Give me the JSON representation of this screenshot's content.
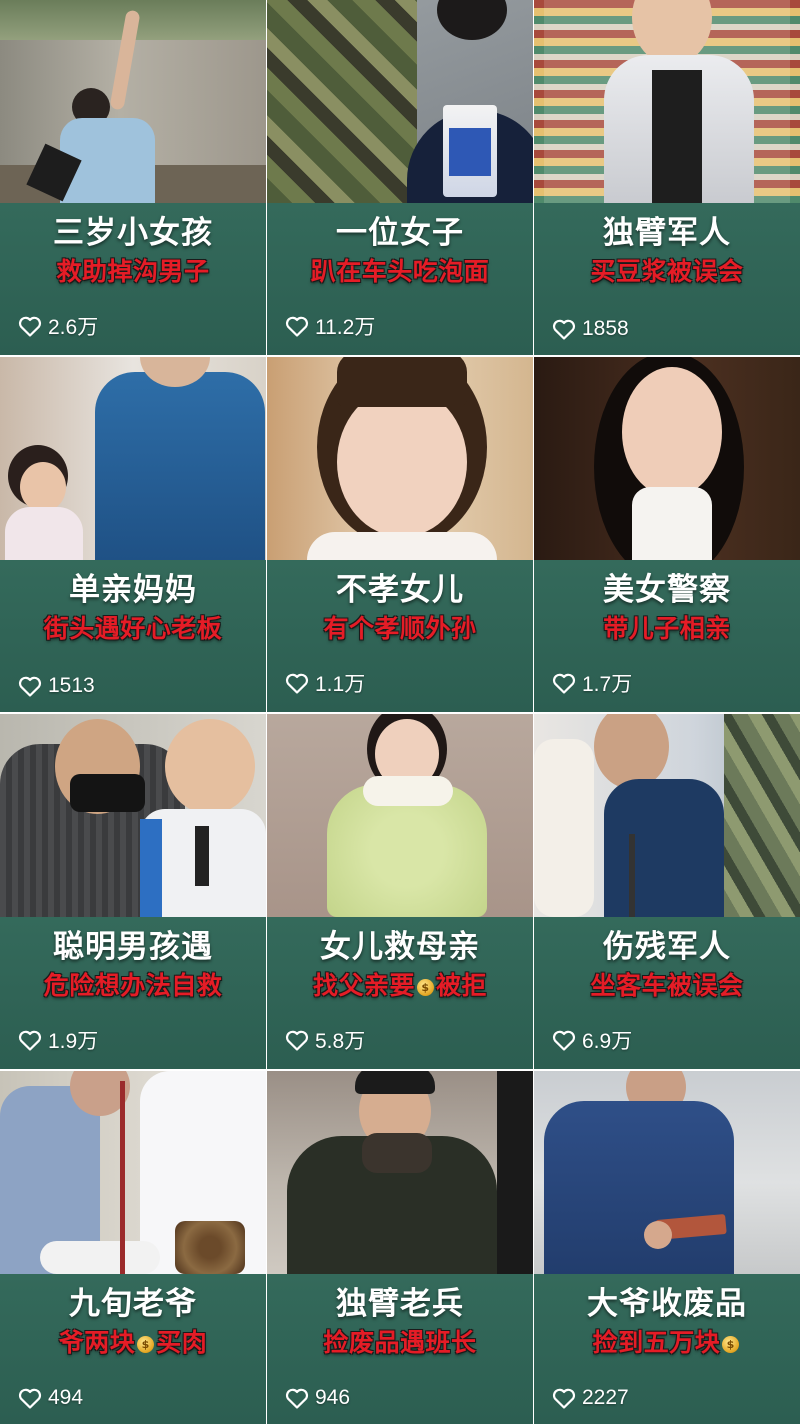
{
  "cards": [
    {
      "title": "三岁小女孩",
      "subtitle_parts": [
        "救助掉沟男子"
      ],
      "likes": "2.6万",
      "thumb": "girl-rescues-man-from-ditch"
    },
    {
      "title": "一位女子",
      "subtitle_parts": [
        "趴在车头吃泡面"
      ],
      "likes": "11.2万",
      "thumb": "woman-eating-instant-noodles-on-car-hood"
    },
    {
      "title": "独臂军人",
      "subtitle_parts": [
        "买豆浆被误会"
      ],
      "likes": "1858",
      "thumb": "man-in-white-jacket-in-shop"
    },
    {
      "title": "单亲妈妈",
      "subtitle_parts": [
        "街头遇好心老板"
      ],
      "likes": "1513",
      "thumb": "girl-and-man-in-blue-shirt"
    },
    {
      "title": "不孝女儿",
      "subtitle_parts": [
        "有个孝顺外孙"
      ],
      "likes": "1.1万",
      "thumb": "crying-girl-closeup"
    },
    {
      "title": "美女警察",
      "subtitle_parts": [
        "带儿子相亲"
      ],
      "likes": "1.7万",
      "thumb": "woman-with-long-hair-portrait"
    },
    {
      "title": "聪明男孩遇",
      "subtitle_parts": [
        "危险想办法自救"
      ],
      "likes": "1.9万",
      "thumb": "masked-man-with-schoolboy"
    },
    {
      "title": "女儿救母亲",
      "subtitle_parts": [
        "找父亲要",
        "被拒"
      ],
      "likes": "5.8万",
      "thumb": "girl-in-green-coat"
    },
    {
      "title": "伤残军人",
      "subtitle_parts": [
        "坐客车被误会"
      ],
      "likes": "6.9万",
      "thumb": "man-on-bus-seat"
    },
    {
      "title": "九旬老爷",
      "subtitle_parts": [
        "爷两块",
        "买肉"
      ],
      "likes": "494",
      "thumb": "old-man-at-market-stall"
    },
    {
      "title": "独臂老兵",
      "subtitle_parts": [
        "捡废品遇班长"
      ],
      "likes": "946",
      "thumb": "smiling-man-in-dark-coat-crouching"
    },
    {
      "title": "大爷收废品",
      "subtitle_parts": [
        "捡到五万块",
        ""
      ],
      "likes": "2227",
      "thumb": "old-man-holding-brick"
    }
  ],
  "icons": {
    "like": "heart-outline-icon",
    "money": "money-bag-icon"
  },
  "colors": {
    "caption_bg": "#336b5c",
    "title": "#ffffff",
    "subtitle": "#e51c26"
  }
}
